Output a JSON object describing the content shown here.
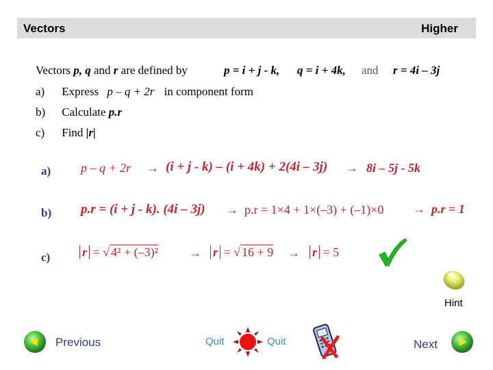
{
  "header": {
    "title": "Vectors",
    "level": "Higher"
  },
  "question": {
    "intro": {
      "text_before": "Vectors",
      "p": "p,",
      "q": "q",
      "and": "and",
      "r": "r",
      "text_after": "are defined by"
    },
    "definitions": {
      "p_def": "p = i + j - k,",
      "q_def": "q = i + 4k,",
      "and": "and",
      "r_def": "r = 4i – 3j"
    },
    "parts": [
      {
        "label": "a)",
        "text": "Express",
        "expr": "p – q + 2r",
        "suffix": "in component form"
      },
      {
        "label": "b)",
        "text": "Calculate",
        "expr": "p.r",
        "suffix": ""
      },
      {
        "label": "c)",
        "text": "Find",
        "expr": "|r|",
        "suffix": ""
      }
    ]
  },
  "answers": {
    "a": {
      "label": "a)",
      "step1": "p – q + 2r",
      "arrow": "→",
      "step2": "(i + j - k) – (i + 4k) + 2(4i – 3j)",
      "result": "8i – 5j - 5k"
    },
    "b": {
      "label": "b)",
      "step1": "p.r = (i + j - k). (4i – 3j)",
      "arrow": "→",
      "step2": "p.r = 1×4 + 1×(–3) + (–1)×0",
      "result": "p.r = 1"
    },
    "c": {
      "label": "c)",
      "step1_lhs": "r",
      "step1_rad": "4² + (–3)²",
      "arrow": "→",
      "step2_lhs": "r",
      "step2_rad": "16 + 9",
      "result_lhs": "r",
      "result_val": "= 5"
    }
  },
  "status": {
    "correct_icon": "green-checkmark"
  },
  "controls": {
    "hint_label": "Hint",
    "previous_label": "Previous",
    "quit_left_label": "Quit",
    "quit_right_label": "Quit",
    "next_label": "Next"
  },
  "colors": {
    "header_bg": "#dcdcdc",
    "answer_red": "#c8202a",
    "label_blue": "#2e3a96",
    "quit_blue": "#3a8fb8",
    "check_green": "#22b422"
  }
}
